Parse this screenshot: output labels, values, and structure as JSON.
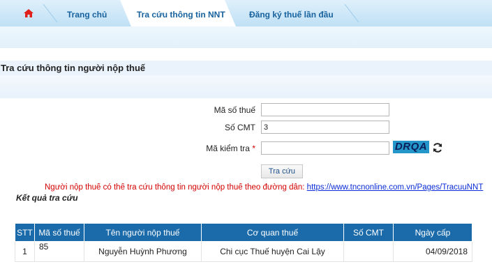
{
  "nav": {
    "tabs": [
      {
        "label": "Trang chủ"
      },
      {
        "label": "Tra cứu thông tin NNT"
      },
      {
        "label": "Đăng ký thuế lần đầu"
      }
    ]
  },
  "section": {
    "title": "Tra cứu thông tin người nộp thuế"
  },
  "form": {
    "tax_code_label": "Mã số thuế",
    "tax_code_value": "",
    "id_label": "Số CMT",
    "id_value": "3",
    "captcha_label": "Mã kiểm tra",
    "captcha_required": "*",
    "captcha_value": "",
    "captcha_text": "DRQA",
    "submit_label": "Tra cứu"
  },
  "notice": {
    "text": "Người nộp thuế có thể tra cứu thông tin người nộp thuế theo đường dẫn: ",
    "link": "https://www.tncnonline.com.vn/Pages/TracuuNNT"
  },
  "results": {
    "title": "Kết quả tra cứu",
    "columns": [
      "STT",
      "Mã số thuế",
      "Tên người nộp thuế",
      "Cơ quan thuế",
      "Số CMT",
      "Ngày cấp"
    ],
    "rows": [
      {
        "stt": "1",
        "tax_code": "85",
        "name": "Nguyễn Huỳnh Phương",
        "office": "Chi cục Thuế huyện Cai Lậy",
        "id_no": "",
        "issue_date": "04/09/2018"
      }
    ]
  },
  "colors": {
    "header_blue": "#1b6bab",
    "notice_red": "#d40000",
    "link_blue": "#0a2bd6",
    "captcha_bg": "#2596c9"
  },
  "icons": {
    "home": "home-icon",
    "refresh": "refresh-icon"
  }
}
